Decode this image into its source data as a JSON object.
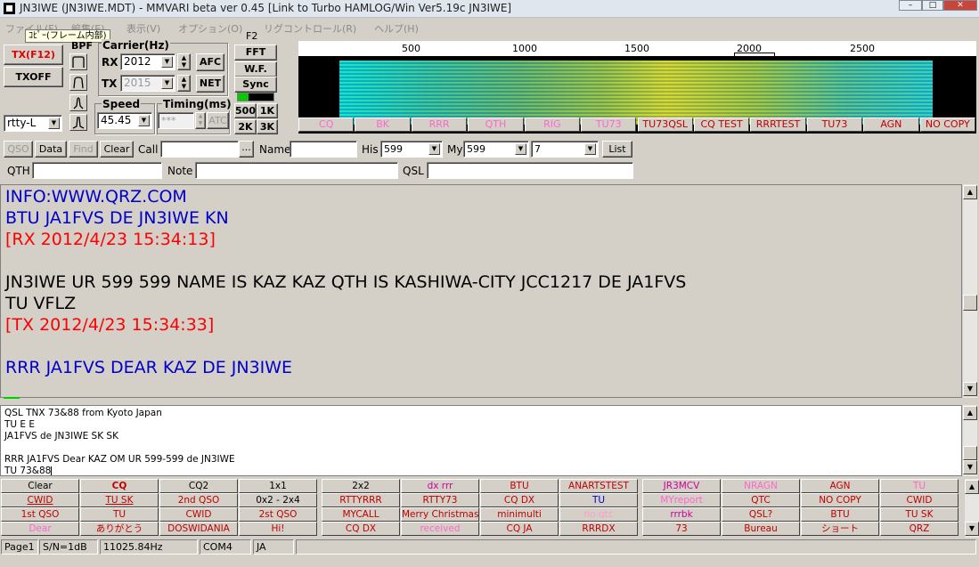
{
  "window": {
    "title": "JN3IWE (JN3IWE.MDT) - MMVARI beta ver 0.45 [Link to Turbo HAMLOG/Win Ver5.19c JN3IWE]",
    "minimize": "–",
    "maximize": "□",
    "close": "✕"
  },
  "menu": {
    "file": "ファイル(F)",
    "edit": "編集(E)",
    "view": "表示(V)",
    "options": "オプション(O)",
    "rig": "リグコントロール(R)",
    "help": "ヘルプ(H)",
    "tooltip": "ｺﾋﾟｰ(フレーム内部)"
  },
  "controls": {
    "tx_label": "TX(F12)",
    "txoff_label": "TXOFF",
    "bpf_label": "BPF",
    "carrier_label": "Carrier(Hz)",
    "rx_label": "RX",
    "rx_value": "2012",
    "tx2_label": "TX",
    "tx_value": "2015",
    "afc_label": "AFC",
    "net_label": "NET",
    "f2_label": "F2",
    "fft_label": "FFT",
    "wf_label": "W.F.",
    "sync_label": "Sync",
    "mode_value": "rtty-L",
    "speed_label": "Speed",
    "speed_value": "45.45",
    "timing_label": "Timing(ms)",
    "timing_value": "***",
    "atc_label": "ATC",
    "bw500": "500",
    "bw1k": "1K",
    "bw2k": "2K",
    "bw3k": "3K"
  },
  "waterfall": {
    "ticks": [
      "500",
      "1000",
      "1500",
      "2000",
      "2500"
    ],
    "macros": [
      {
        "label": "CQ",
        "color": "#ff66cc"
      },
      {
        "label": "BK",
        "color": "#ff66cc"
      },
      {
        "label": "RRR",
        "color": "#ff66cc"
      },
      {
        "label": "QTH",
        "color": "#ff66cc"
      },
      {
        "label": "RIG",
        "color": "#ff66cc"
      },
      {
        "label": "TU73",
        "color": "#ff66cc"
      },
      {
        "label": "TU73QSL",
        "color": "#c00000"
      },
      {
        "label": "CQ TEST",
        "color": "#c00000"
      },
      {
        "label": "RRRTEST",
        "color": "#c00000"
      },
      {
        "label": "TU73",
        "color": "#c00000"
      },
      {
        "label": "AGN",
        "color": "#c00000"
      },
      {
        "label": "NO COPY",
        "color": "#c00000"
      }
    ]
  },
  "log": {
    "qso": "QSO",
    "data": "Data",
    "find": "Find",
    "clear": "Clear",
    "call_label": "Call",
    "call_btn": "...",
    "name_label": "Name",
    "his_label": "His",
    "his_value": "599",
    "my_label": "My",
    "my_value": "599",
    "band_value": "7",
    "list_label": "List",
    "qth_label": "QTH",
    "note_label": "Note",
    "qsl_label": "QSL"
  },
  "rx_text": [
    {
      "text": " INFO:WWW.QRZ.COM",
      "color": "#0000cc"
    },
    {
      "text": "BTU JA1FVS DE JN3IWE KN",
      "color": "#0000cc"
    },
    {
      "text": "[RX 2012/4/23 15:34:13]",
      "color": "#ff0000"
    },
    {
      "text": "",
      "color": "#000000"
    },
    {
      "text": " JN3IWE UR 599 599  NAME IS KAZ KAZ  QTH IS KASHIWA-CITY JCC1217 DE JA1FVS",
      "color": "#000000"
    },
    {
      "text": "TU VFLZ",
      "color": "#000000"
    },
    {
      "text": "[TX 2012/4/23 15:34:33]",
      "color": "#ff0000"
    },
    {
      "text": "",
      "color": "#000000"
    },
    {
      "text": "RRR JA1FVS DEAR KAZ DE JN3IWE",
      "color": "#0000cc"
    }
  ],
  "tx_text": [
    "QSL TNX 73&88  from Kyoto Japan",
    "TU E E",
    " JA1FVS de JN3IWE SK SK",
    "",
    "RRR JA1FVS Dear KAZ OM UR 599-599 de JN3IWE",
    "TU 73&88"
  ],
  "macros": [
    [
      {
        "label": "Clear",
        "color": "#000000"
      },
      {
        "label": "CQ",
        "color": "#c00000",
        "bold": true
      },
      {
        "label": "CQ2",
        "color": "#000000"
      },
      {
        "label": "1x1",
        "color": "#000000"
      },
      {
        "label": "2x2",
        "color": "#000000"
      },
      {
        "label": "dx rrr",
        "color": "#cc0099"
      },
      {
        "label": "BTU",
        "color": "#c00000"
      },
      {
        "label": "ANARTSTEST",
        "color": "#c00000"
      },
      {
        "label": "JR3MCV",
        "color": "#cc0099"
      },
      {
        "label": "NRAGN",
        "color": "#ff66cc"
      },
      {
        "label": "AGN",
        "color": "#c00000"
      },
      {
        "label": "TU",
        "color": "#ff66cc"
      }
    ],
    [
      {
        "label": "CWID",
        "color": "#c00000",
        "underline": true
      },
      {
        "label": "TU SK",
        "color": "#c00000",
        "underline": true
      },
      {
        "label": "2nd QSO",
        "color": "#c00000"
      },
      {
        "label": "0x2 - 2x4",
        "color": "#000000"
      },
      {
        "label": "RTTYRRR",
        "color": "#c00000"
      },
      {
        "label": "RTTY73",
        "color": "#c00000"
      },
      {
        "label": "CQ DX",
        "color": "#c00000"
      },
      {
        "label": "TU",
        "color": "#0000cc"
      },
      {
        "label": "MYreport",
        "color": "#ff66cc"
      },
      {
        "label": "QTC",
        "color": "#c00000"
      },
      {
        "label": "NO COPY",
        "color": "#c00000"
      },
      {
        "label": "CWID",
        "color": "#c00000"
      }
    ],
    [
      {
        "label": "1st QSO",
        "color": "#c00000"
      },
      {
        "label": "TU",
        "color": "#c00000"
      },
      {
        "label": "CWID",
        "color": "#c00000"
      },
      {
        "label": "2st QSO",
        "color": "#c00000"
      },
      {
        "label": "MYCALL",
        "color": "#c00000"
      },
      {
        "label": "Merry Christmas",
        "color": "#c00000"
      },
      {
        "label": "minimulti",
        "color": "#c00000"
      },
      {
        "label": "no qtc",
        "color": "#ff99cc"
      },
      {
        "label": "rrrbk",
        "color": "#cc0099"
      },
      {
        "label": "QSL?",
        "color": "#c00000"
      },
      {
        "label": "BTU",
        "color": "#c00000"
      },
      {
        "label": "TU SK",
        "color": "#c00000"
      }
    ],
    [
      {
        "label": "Dear",
        "color": "#ff66cc"
      },
      {
        "label": "ありがとう",
        "color": "#c00000"
      },
      {
        "label": "DOSWIDANIA",
        "color": "#c00000"
      },
      {
        "label": "Hi!",
        "color": "#c00000"
      },
      {
        "label": "CQ DX",
        "color": "#c00000"
      },
      {
        "label": "received",
        "color": "#ff66cc"
      },
      {
        "label": "CQ JA",
        "color": "#c00000"
      },
      {
        "label": "RRRDX",
        "color": "#c00000"
      },
      {
        "label": "73",
        "color": "#c00000"
      },
      {
        "label": "Bureau",
        "color": "#c00000"
      },
      {
        "label": "ショート",
        "color": "#c00000"
      },
      {
        "label": "QRZ",
        "color": "#c00000"
      }
    ]
  ],
  "status": {
    "page": "Page1",
    "sn": "S/N=1dB",
    "freq": "11025.84Hz",
    "port": "COM4",
    "lang": "JA"
  }
}
